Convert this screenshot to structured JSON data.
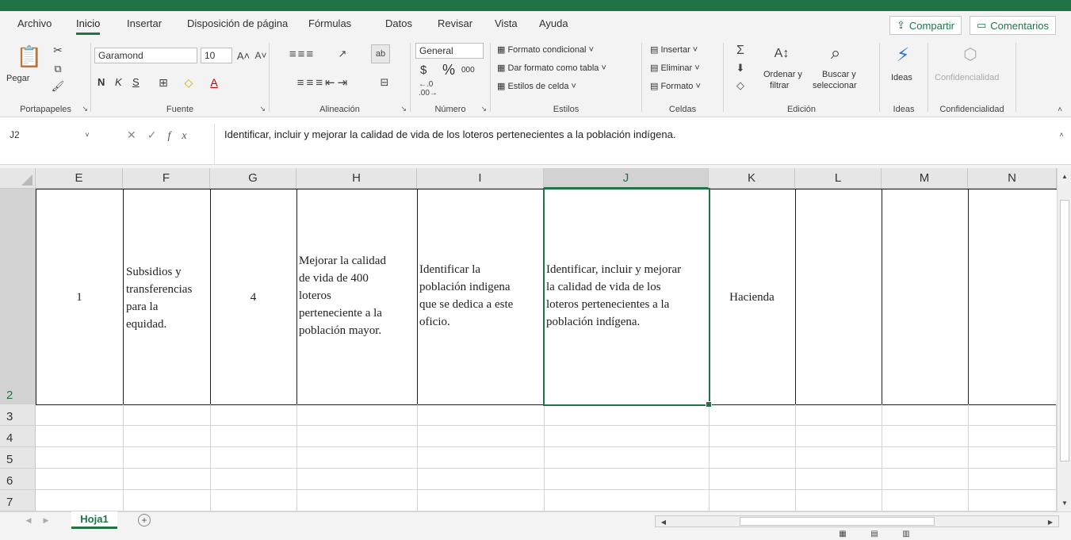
{
  "menu": {
    "tabs": [
      "Archivo",
      "Inicio",
      "Insertar",
      "Disposición de página",
      "Fórmulas",
      "Datos",
      "Revisar",
      "Vista",
      "Ayuda"
    ],
    "active_tab": "Inicio",
    "share_label": "Compartir",
    "comments_label": "Comentarios"
  },
  "ribbon": {
    "clipboard": {
      "paste_label": "Pegar",
      "group_label": "Portapapeles"
    },
    "font": {
      "font_name": "Garamond",
      "font_size": "10",
      "bold": "N",
      "italic": "K",
      "underline": "S",
      "group_label": "Fuente"
    },
    "alignment": {
      "group_label": "Alineación"
    },
    "number": {
      "format": "General",
      "currency": "$",
      "percent": "%",
      "thousands": "000",
      "group_label": "Número"
    },
    "styles": {
      "conditional": "Formato condicional",
      "as_table": "Dar formato como tabla",
      "cell_styles": "Estilos de celda",
      "group_label": "Estilos"
    },
    "cells": {
      "insert": "Insertar",
      "delete": "Eliminar",
      "format": "Formato",
      "group_label": "Celdas"
    },
    "editing": {
      "sort_filter_1": "Ordenar y",
      "sort_filter_2": "filtrar",
      "find_1": "Buscar y",
      "find_2": "seleccionar",
      "group_label": "Edición"
    },
    "ideas": {
      "label": "Ideas",
      "group_label": "Ideas"
    },
    "sensitivity": {
      "label": "Confidencialidad",
      "group_label": "Confidencialidad"
    }
  },
  "formula_bar": {
    "name_box": "J2",
    "fx": "fx",
    "content": "Identificar, incluir y mejorar la calidad de vida de los loteros pertenecientes a la población indígena."
  },
  "grid": {
    "columns": [
      "E",
      "F",
      "G",
      "H",
      "I",
      "J",
      "K",
      "L",
      "M",
      "N"
    ],
    "selected_column": "J",
    "rows": [
      "2",
      "3",
      "4",
      "5",
      "6",
      "7"
    ],
    "cells": {
      "E2": "1",
      "F2": "Subsidios y\ntransferencias\npara la\nequidad.",
      "G2": "4",
      "H2": "Mejorar la calidad\nde vida de 400\nloteros\nperteneciente a la\npoblación mayor.",
      "I2": "Identificar la\npoblación indigena\nque se dedica a este\noficio.",
      "J2": "Identificar, incluir y mejorar\nla calidad de vida de los\nloteros pertenecientes a la\npoblación indígena.",
      "K2": "Hacienda"
    }
  },
  "sheets": {
    "tabs": [
      "Hoja1"
    ],
    "active": "Hoja1",
    "add_symbol": "+"
  }
}
